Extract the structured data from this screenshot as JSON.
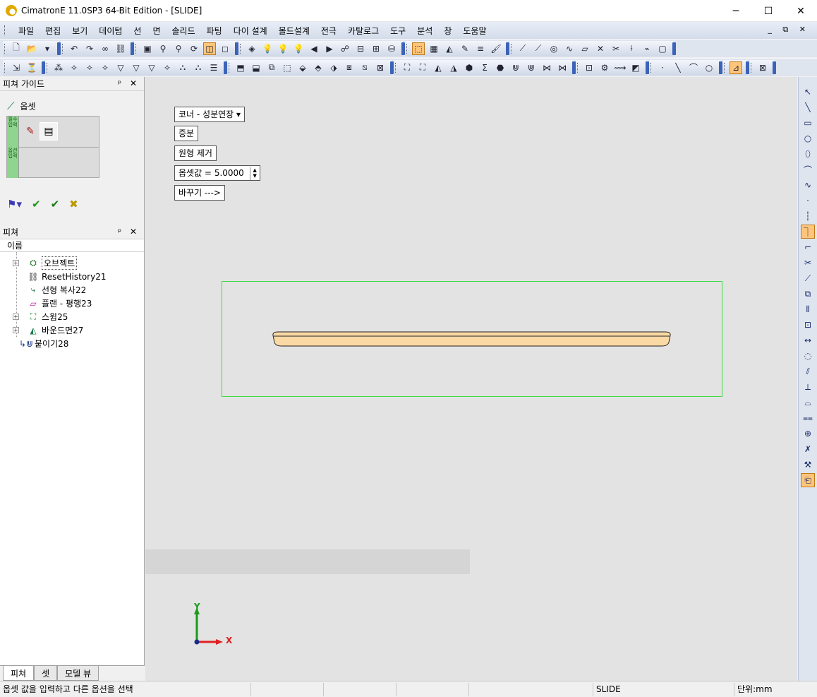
{
  "window": {
    "title": "CimatronE 11.0SP3 64-Bit Edition - [SLIDE]",
    "controls": [
      "─",
      "☐",
      "✕"
    ]
  },
  "menu": [
    "파일",
    "편집",
    "보기",
    "데이텀",
    "선",
    "면",
    "솔리드",
    "파팅",
    "다이 설계",
    "몰드설계",
    "전극",
    "카탈로그",
    "도구",
    "분석",
    "창",
    "도움말"
  ],
  "mdi_controls": "_ ⧉ ✕",
  "feature_guide": {
    "header": "피쳐 가이드",
    "controls": "ᵖ ✕",
    "step_label": "옵셋",
    "strip_text_1": "필수 입력",
    "strip_text_2": "옵션 입력"
  },
  "features": {
    "header": "피쳐",
    "controls": "ᵖ ✕",
    "column": "이름",
    "items": [
      {
        "label": "오브젝트",
        "icon": "object-group-icon"
      },
      {
        "label": "ResetHistory21",
        "icon": "reset-history-icon"
      },
      {
        "label": "선형 복사22",
        "icon": "linear-copy-icon"
      },
      {
        "label": "플랜 - 평행23",
        "icon": "plane-parallel-icon"
      },
      {
        "label": "스윕25",
        "icon": "sweep-icon"
      },
      {
        "label": "바운드면27",
        "icon": "bounded-face-icon"
      },
      {
        "label": "붙이기28",
        "icon": "attach-icon"
      }
    ]
  },
  "bottom_tabs": [
    "피쳐",
    "셋",
    "모델 뷰"
  ],
  "options": {
    "corner": "코너 - 성분연장 ▾",
    "increment": "증분",
    "remove_round": "원형 제거",
    "offset_label": "옵셋값 = ",
    "offset_value": "5.0000",
    "swap": "바꾸기 --->"
  },
  "axes": {
    "y": "Y",
    "x": "X"
  },
  "status": {
    "message": "옵셋 값을 입력하고 다른 옵션을 선택",
    "model": "SLIDE",
    "units": "단위:mm"
  },
  "colors": {
    "frame": "#3fdc3f",
    "part_fill": "#fbd9a4",
    "axis_x": "#e02020",
    "axis_y": "#1a9a1a",
    "highlight": "#ffc57a"
  }
}
